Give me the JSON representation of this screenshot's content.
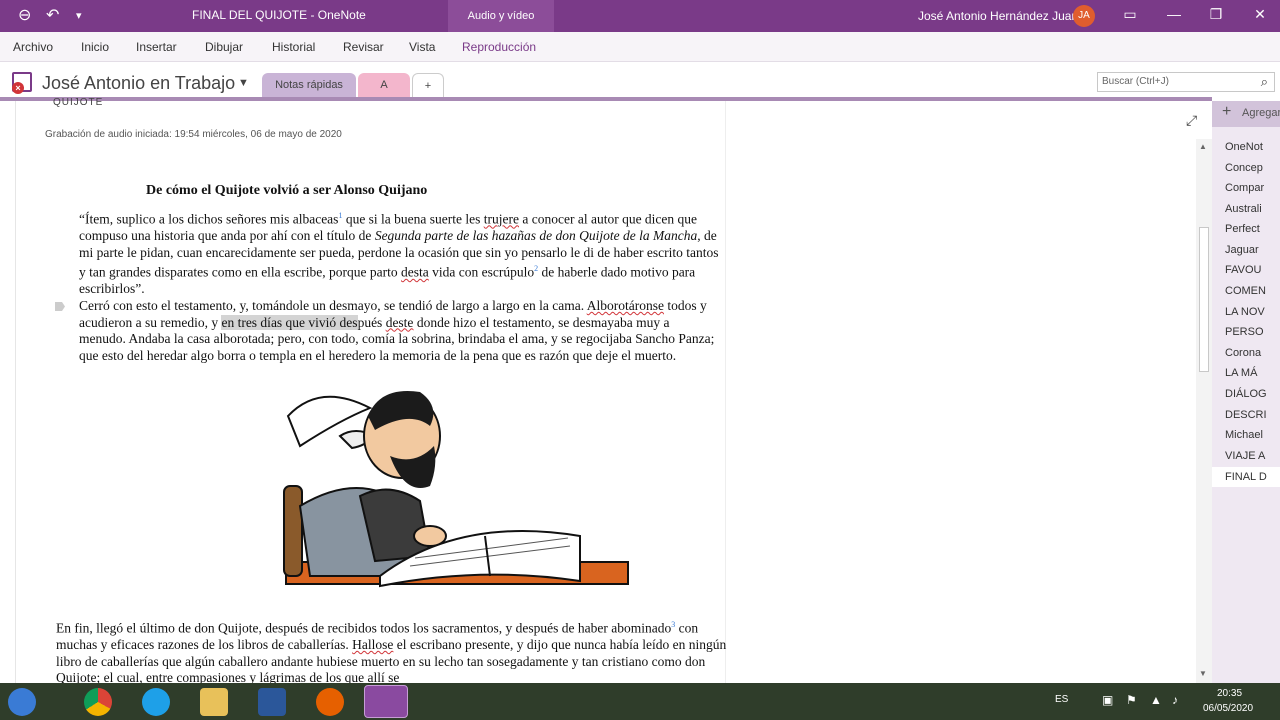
{
  "titlebar": {
    "title": "FINAL DEL QUIJOTE  -  OneNote",
    "context_tab": "Audio y vídeo",
    "user": "José Antonio Hernández Juan",
    "initials": "JA"
  },
  "menu": [
    "Archivo",
    "Inicio",
    "Insertar",
    "Dibujar",
    "Historial",
    "Revisar",
    "Vista",
    "Reproducción"
  ],
  "notebook": {
    "name": "José Antonio en Trabajo",
    "sections": [
      "Notas rápidas",
      "A",
      "+"
    ],
    "search_placeholder": "Buscar (Ctrl+J)"
  },
  "page": {
    "title_fragment": "QUIJOTE",
    "recording_note": "Grabación de audio iniciada: 19:54 miércoles, 06 de mayo de 2020",
    "heading": "De cómo el Quijote volvió a ser Alonso Quijano",
    "p1": {
      "a": "“Ítem, suplico a los dichos señores mis albaceas",
      "sup1": "1",
      "b": " que si la buena suerte les ",
      "c": "trujere",
      "d": " a conocer al autor que dicen que compuso una historia que anda por ahí con el título de ",
      "e": "Segunda parte de las hazañas de don Quijote de la Mancha",
      "f": ", de mi parte le pidan, cuan encarecidamente ser pueda, perdone la ocasión que sin yo pensarlo le di de haber escrito tantos y tan grandes disparates como en ella escribe, porque parto ",
      "g": "desta",
      "h": " vida con escrúpulo",
      "sup2": "2",
      "i": " de haberle dado motivo para escribirlos”."
    },
    "p2": {
      "a": "Cerró con esto el testamento, y, tomándole un desmayo, se tendió de largo a largo en la cama. ",
      "b": "Alborotáronse",
      "c": " todos y acudieron a su remedio, y ",
      "d": "en tres días que vivió des",
      "e": "pués ",
      "f": "deste",
      "g": " donde hizo el testamento, se desmayaba muy a menudo. Andaba la casa alborotada; pero, con todo, comía la sobrina, brindaba el ama, y se regocijaba Sancho Panza; que esto del heredar algo borra o templa en el heredero la memoria de la pena que es razón que deje el muerto."
    },
    "p3": {
      "a": "En fin, llegó el último de don Quijote, después de recibidos todos los sacramentos, y después de haber abominado",
      "sup": "3",
      "b": " con muchas y eficaces razones de los libros de caballerías. ",
      "c": "Hallose",
      "d": " el escribano presente, y dijo que nunca había leído en ningún libro de caballerías que algún caballero andante hubiese muerto en su lecho tan sosegadamente y tan cristiano como don Quijote; el cual, entre compasiones y lágrimas de los que allí se"
    }
  },
  "pages_panel": {
    "add_label": "Agregar",
    "items": [
      "OneNot",
      "Concep",
      "Compar",
      "Australi",
      "Perfect",
      "Jaguar",
      "FAVOU",
      "COMEN",
      "LA NOV",
      "PERSO",
      "Corona",
      "LA MÁ",
      "DIÁLOG",
      "DESCRI",
      "Michael",
      "VIAJE A",
      "FINAL D"
    ]
  },
  "taskbar": {
    "lang": "ES",
    "time": "20:35",
    "date": "06/05/2020"
  },
  "colors": {
    "accent": "#7a3a88",
    "section_notas": "#c9b4d6",
    "section_a": "#f3b6cc"
  }
}
